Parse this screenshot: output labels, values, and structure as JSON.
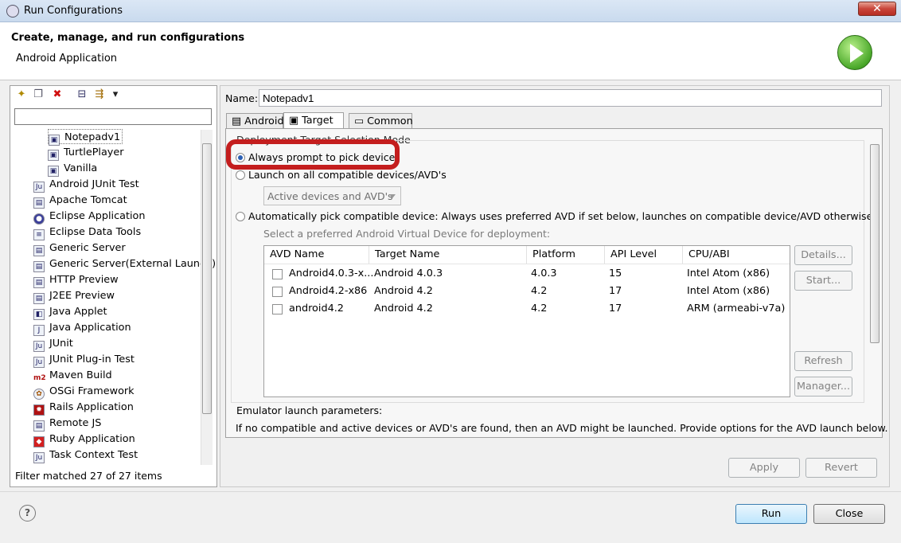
{
  "window": {
    "title": "Run Configurations",
    "close_glyph": "✕"
  },
  "header": {
    "title": "Create, manage, and run configurations",
    "subtitle": "Android Application"
  },
  "left": {
    "toolbar": [
      {
        "icon": "new-config-icon",
        "glyph": "✦"
      },
      {
        "icon": "duplicate-icon",
        "glyph": "❐"
      },
      {
        "icon": "delete-icon",
        "glyph": "✖"
      },
      {
        "icon": "collapse-all-icon",
        "glyph": "⊟"
      },
      {
        "icon": "filter-icon",
        "glyph": "⇶"
      },
      {
        "icon": "menu-chevron-icon",
        "glyph": "▾"
      }
    ],
    "filter_value": "",
    "configs": [
      "Notepadv1",
      "TurtlePlayer",
      "Vanilla"
    ],
    "types": [
      "Android JUnit Test",
      "Apache Tomcat",
      "Eclipse Application",
      "Eclipse Data Tools",
      "Generic Server",
      "Generic Server(External Launch)",
      "HTTP Preview",
      "J2EE Preview",
      "Java Applet",
      "Java Application",
      "JUnit",
      "JUnit Plug-in Test",
      "Maven Build",
      "OSGi Framework",
      "Rails Application",
      "Remote JS",
      "Ruby Application",
      "Task Context Test"
    ],
    "filter_status": "Filter matched 27 of 27 items"
  },
  "right": {
    "name_label": "Name:",
    "name_value": "Notepadv1",
    "tabs": [
      "Android",
      "Target",
      "Common"
    ],
    "section_title": "Deployment Target Selection Mode",
    "opt1": "Always prompt to pick device",
    "opt2": "Launch on all compatible devices/AVD's",
    "combo": "Active devices and AVD's",
    "opt3": "Automatically pick compatible device: Always uses preferred AVD if set below, launches on compatible device/AVD otherwise.",
    "avd_hint": "Select a preferred Android Virtual Device for deployment:",
    "columns": [
      "AVD Name",
      "Target Name",
      "Platform",
      "API Level",
      "CPU/ABI"
    ],
    "rows": [
      [
        "Android4.0.3-x...",
        "Android 4.0.3",
        "4.0.3",
        "15",
        "Intel Atom (x86)"
      ],
      [
        "Android4.2-x86",
        "Android 4.2",
        "4.2",
        "17",
        "Intel Atom (x86)"
      ],
      [
        "android4.2",
        "Android 4.2",
        "4.2",
        "17",
        "ARM (armeabi-v7a)"
      ]
    ],
    "side_buttons": [
      "Details...",
      "Start...",
      "Refresh",
      "Manager..."
    ],
    "emu_title": "Emulator launch parameters:",
    "emu_text": "If no compatible and active devices or AVD's are found, then an AVD might be launched. Provide options for the AVD launch below."
  },
  "footer": {
    "apply": "Apply",
    "revert": "Revert",
    "run": "Run",
    "close": "Close",
    "help": "?"
  }
}
